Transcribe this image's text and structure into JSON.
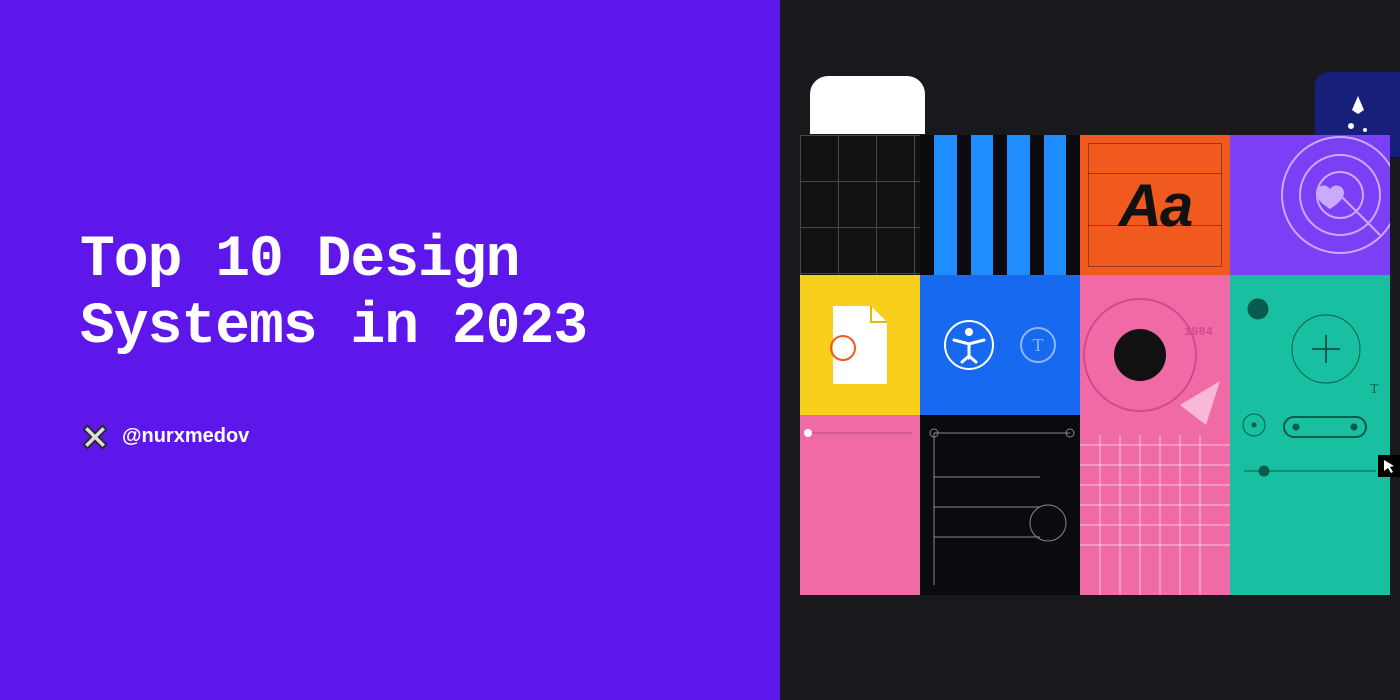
{
  "colors": {
    "panel_purple": "#5e17eb",
    "bg_dark": "#18181d",
    "tiles": {
      "stripe_blue": "#1f8cff",
      "orange": "#f05a1f",
      "violet": "#7b3ff5",
      "yellow": "#f8cf1d",
      "blue": "#1769ef",
      "pink": "#f06ba6",
      "teal": "#18bfa0"
    }
  },
  "left": {
    "title": "Top 10 Design\nSystems in 2023",
    "author_handle": "@nurxmedov"
  },
  "tiles": {
    "orange_type_sample": "Aa",
    "pink_year_label": "1984"
  }
}
